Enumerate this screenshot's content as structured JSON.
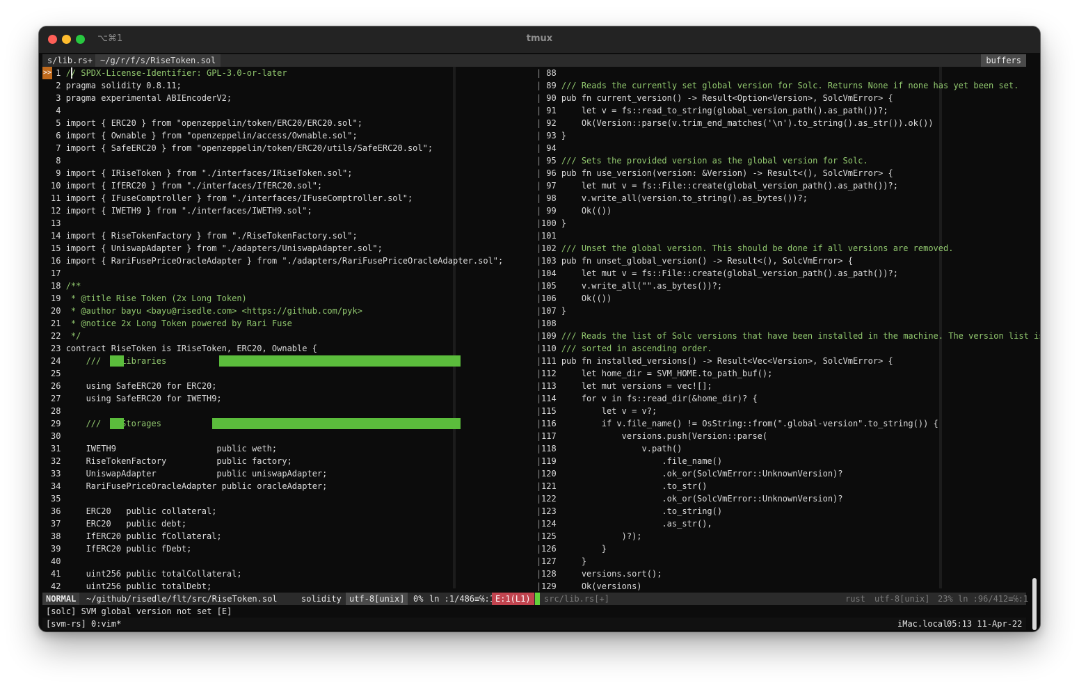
{
  "window": {
    "title": "tmux",
    "tab_shortcut": "⌥⌘1",
    "colors": {
      "accent_green": "#5bbd3c",
      "error_red": "#c1444f",
      "gutter_orange": "#c06a1d"
    }
  },
  "tabline": {
    "tabs": [
      {
        "label": "s/lib.rs+"
      },
      {
        "label": "~/g/r/f/s/RiseToken.sol"
      }
    ],
    "buffers_label": "buffers"
  },
  "left_pane": {
    "gutter_marker": ">>",
    "lines": [
      {
        "n": " 1",
        "t": "// SPDX-License-Identifier: GPL-3.0-or-later"
      },
      {
        "n": " 2",
        "t": "pragma solidity 0.8.11;"
      },
      {
        "n": " 3",
        "t": "pragma experimental ABIEncoderV2;"
      },
      {
        "n": " 4",
        "t": ""
      },
      {
        "n": " 5",
        "t": "import { ERC20 } from \"openzeppelin/token/ERC20/ERC20.sol\";"
      },
      {
        "n": " 6",
        "t": "import { Ownable } from \"openzeppelin/access/Ownable.sol\";"
      },
      {
        "n": " 7",
        "t": "import { SafeERC20 } from \"openzeppelin/token/ERC20/utils/SafeERC20.sol\";"
      },
      {
        "n": " 8",
        "t": ""
      },
      {
        "n": " 9",
        "t": "import { IRiseToken } from \"./interfaces/IRiseToken.sol\";"
      },
      {
        "n": "10",
        "t": "import { IfERC20 } from \"./interfaces/IfERC20.sol\";"
      },
      {
        "n": "11",
        "t": "import { IFuseComptroller } from \"./interfaces/IFuseComptroller.sol\";"
      },
      {
        "n": "12",
        "t": "import { IWETH9 } from \"./interfaces/IWETH9.sol\";"
      },
      {
        "n": "13",
        "t": ""
      },
      {
        "n": "14",
        "t": "import { RiseTokenFactory } from \"./RiseTokenFactory.sol\";"
      },
      {
        "n": "15",
        "t": "import { UniswapAdapter } from \"./adapters/UniswapAdapter.sol\";"
      },
      {
        "n": "16",
        "t": "import { RariFusePriceOracleAdapter } from \"./adapters/RariFusePriceOracleAdapter.sol\";"
      },
      {
        "n": "17",
        "t": ""
      },
      {
        "n": "18",
        "t": "/**"
      },
      {
        "n": "19",
        "t": " * @title Rise Token (2x Long Token)"
      },
      {
        "n": "20",
        "t": " * @author bayu <bayu@risedle.com> <https://github.com/pyk>"
      },
      {
        "n": "21",
        "t": " * @notice 2x Long Token powered by Rari Fuse"
      },
      {
        "n": "22",
        "t": " */"
      },
      {
        "n": "23",
        "t": "contract RiseToken is IRiseToken, ERC20, Ownable {"
      },
      {
        "n": "24",
        "t": "    ///    Libraries"
      },
      {
        "n": "25",
        "t": ""
      },
      {
        "n": "26",
        "t": "    using SafeERC20 for ERC20;"
      },
      {
        "n": "27",
        "t": "    using SafeERC20 for IWETH9;"
      },
      {
        "n": "28",
        "t": ""
      },
      {
        "n": "29",
        "t": "    ///    Storages"
      },
      {
        "n": "30",
        "t": ""
      },
      {
        "n": "31",
        "t": "    IWETH9                    public weth;"
      },
      {
        "n": "32",
        "t": "    RiseTokenFactory          public factory;"
      },
      {
        "n": "33",
        "t": "    UniswapAdapter            public uniswapAdapter;"
      },
      {
        "n": "34",
        "t": "    RariFusePriceOracleAdapter public oracleAdapter;"
      },
      {
        "n": "35",
        "t": ""
      },
      {
        "n": "36",
        "t": "    ERC20   public collateral;"
      },
      {
        "n": "37",
        "t": "    ERC20   public debt;"
      },
      {
        "n": "38",
        "t": "    IfERC20 public fCollateral;"
      },
      {
        "n": "39",
        "t": "    IfERC20 public fDebt;"
      },
      {
        "n": "40",
        "t": ""
      },
      {
        "n": "41",
        "t": "    uint256 public totalCollateral;"
      },
      {
        "n": "42",
        "t": "    uint256 public totalDebt;"
      }
    ]
  },
  "right_pane": {
    "lines": [
      {
        "n": " 88",
        "t": ""
      },
      {
        "n": " 89",
        "t": "/// Reads the currently set global version for Solc. Returns None if none has yet been set."
      },
      {
        "n": " 90",
        "t": "pub fn current_version() -> Result<Option<Version>, SolcVmError> {"
      },
      {
        "n": " 91",
        "t": "    let v = fs::read_to_string(global_version_path().as_path())?;"
      },
      {
        "n": " 92",
        "t": "    Ok(Version::parse(v.trim_end_matches('\\n').to_string().as_str()).ok())"
      },
      {
        "n": " 93",
        "t": "}"
      },
      {
        "n": " 94",
        "t": ""
      },
      {
        "n": " 95",
        "t": "/// Sets the provided version as the global version for Solc."
      },
      {
        "n": " 96",
        "t": "pub fn use_version(version: &Version) -> Result<(), SolcVmError> {"
      },
      {
        "n": " 97",
        "t": "    let mut v = fs::File::create(global_version_path().as_path())?;"
      },
      {
        "n": " 98",
        "t": "    v.write_all(version.to_string().as_bytes())?;"
      },
      {
        "n": " 99",
        "t": "    Ok(())"
      },
      {
        "n": "100",
        "t": "}"
      },
      {
        "n": "101",
        "t": ""
      },
      {
        "n": "102",
        "t": "/// Unset the global version. This should be done if all versions are removed."
      },
      {
        "n": "103",
        "t": "pub fn unset_global_version() -> Result<(), SolcVmError> {"
      },
      {
        "n": "104",
        "t": "    let mut v = fs::File::create(global_version_path().as_path())?;"
      },
      {
        "n": "105",
        "t": "    v.write_all(\"\".as_bytes())?;"
      },
      {
        "n": "106",
        "t": "    Ok(())"
      },
      {
        "n": "107",
        "t": "}"
      },
      {
        "n": "108",
        "t": ""
      },
      {
        "n": "109",
        "t": "/// Reads the list of Solc versions that have been installed in the machine. The version list is"
      },
      {
        "n": "110",
        "t": "/// sorted in ascending order."
      },
      {
        "n": "111",
        "t": "pub fn installed_versions() -> Result<Vec<Version>, SolcVmError> {"
      },
      {
        "n": "112",
        "t": "    let home_dir = SVM_HOME.to_path_buf();"
      },
      {
        "n": "113",
        "t": "    let mut versions = vec![];"
      },
      {
        "n": "114",
        "t": "    for v in fs::read_dir(&home_dir)? {"
      },
      {
        "n": "115",
        "t": "        let v = v?;"
      },
      {
        "n": "116",
        "t": "        if v.file_name() != OsString::from(\".global-version\".to_string()) {"
      },
      {
        "n": "117",
        "t": "            versions.push(Version::parse("
      },
      {
        "n": "118",
        "t": "                v.path()"
      },
      {
        "n": "119",
        "t": "                    .file_name()"
      },
      {
        "n": "120",
        "t": "                    .ok_or(SolcVmError::UnknownVersion)?"
      },
      {
        "n": "121",
        "t": "                    .to_str()"
      },
      {
        "n": "122",
        "t": "                    .ok_or(SolcVmError::UnknownVersion)?"
      },
      {
        "n": "123",
        "t": "                    .to_string()"
      },
      {
        "n": "124",
        "t": "                    .as_str(),"
      },
      {
        "n": "125",
        "t": "            )?);"
      },
      {
        "n": "126",
        "t": "        }"
      },
      {
        "n": "127",
        "t": "    }"
      },
      {
        "n": "128",
        "t": "    versions.sort();"
      },
      {
        "n": "129",
        "t": "    Ok(versions)"
      }
    ]
  },
  "statusline": {
    "mode": "NORMAL",
    "file_path": "~/github/risedle/flt/src/RiseToken.sol",
    "filetype": "solidity",
    "encoding": "utf-8[unix]",
    "percent": "0%",
    "position": "ln :1/486≡℅:1",
    "error": "E:1(L1)",
    "right_file": "src/lib.rs[+]",
    "right_filetype": "rust",
    "right_encoding": "utf-8[unix]",
    "right_percent": "23%",
    "right_position": "ln :96/412≡℅:1"
  },
  "message": "[solc] SVM global version not set [E]",
  "tmux": {
    "session": "[svm-rs] 0:vim*",
    "host": "iMac.local",
    "time": "05:13 11-Apr-22"
  }
}
